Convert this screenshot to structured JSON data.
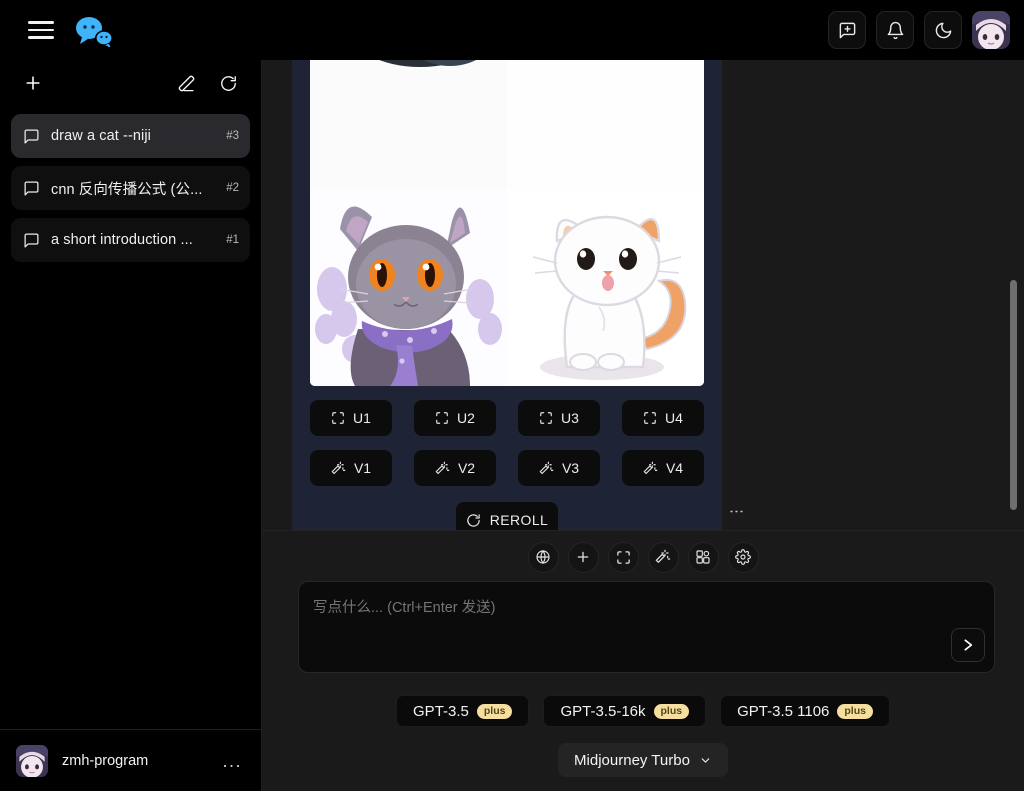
{
  "app": {
    "brand_logo": "wechat-bubbles-logo",
    "brand_color": "#38b5fd",
    "background": "#1a1a1a",
    "bubble_color": "#1e2335"
  },
  "topbar": {
    "menu_icon": "hamburger-icon",
    "actions": [
      {
        "icon": "new-chat-icon",
        "name": "new-chat-button"
      },
      {
        "icon": "bell-icon",
        "name": "notifications-button"
      },
      {
        "icon": "moon-icon",
        "name": "dark-mode-button"
      }
    ],
    "avatar_name": "user-avatar"
  },
  "sidebar": {
    "new_icon": "plus-icon",
    "erase_icon": "eraser-icon",
    "refresh_icon": "refresh-icon",
    "conversations": [
      {
        "title": "draw a cat --niji",
        "count": "#3",
        "active": true
      },
      {
        "title": "cnn 反向传播公式 (公...",
        "count": "#2",
        "active": false
      },
      {
        "title": "a short introduction ...",
        "count": "#1",
        "active": false
      }
    ],
    "footer": {
      "username": "zmh-program",
      "more_icon": "more-dots-icon",
      "more_label": "..."
    }
  },
  "main": {
    "message": {
      "image_grid_alt": "midjourney-cat-grid",
      "upscale_buttons": [
        {
          "label": "U1",
          "icon": "expand-icon"
        },
        {
          "label": "U2",
          "icon": "expand-icon"
        },
        {
          "label": "U3",
          "icon": "expand-icon"
        },
        {
          "label": "U4",
          "icon": "expand-icon"
        }
      ],
      "variation_buttons": [
        {
          "label": "V1",
          "icon": "magic-wand-icon"
        },
        {
          "label": "V2",
          "icon": "magic-wand-icon"
        },
        {
          "label": "V3",
          "icon": "magic-wand-icon"
        },
        {
          "label": "V4",
          "icon": "magic-wand-icon"
        }
      ],
      "reroll": {
        "label": "REROLL",
        "icon": "reroll-icon"
      },
      "more_icon": "vertical-dots-icon",
      "more_label": "⋮"
    },
    "scrollbar": {
      "name": "chat-scrollbar"
    }
  },
  "composer": {
    "tools": [
      {
        "icon": "globe-icon",
        "name": "web-browsing-button"
      },
      {
        "icon": "plus-icon",
        "name": "add-attachment-button"
      },
      {
        "icon": "expand-icon",
        "name": "fullscreen-button"
      },
      {
        "icon": "magic-wand-icon",
        "name": "magic-button"
      },
      {
        "icon": "apps-grid-icon",
        "name": "apps-button"
      },
      {
        "icon": "gear-icon",
        "name": "settings-button"
      }
    ],
    "input": {
      "value": "",
      "placeholder": "写点什么... (Ctrl+Enter 发送)"
    },
    "send_button": {
      "icon": "send-arrow-icon",
      "label": "➤"
    },
    "models": [
      {
        "name": "GPT-3.5",
        "badge": "plus"
      },
      {
        "name": "GPT-3.5-16k",
        "badge": "plus"
      },
      {
        "name": "GPT-3.5 1106",
        "badge": "plus"
      }
    ],
    "model_select": {
      "value": "Midjourney Turbo",
      "chevron": "chevron-down-icon"
    }
  }
}
